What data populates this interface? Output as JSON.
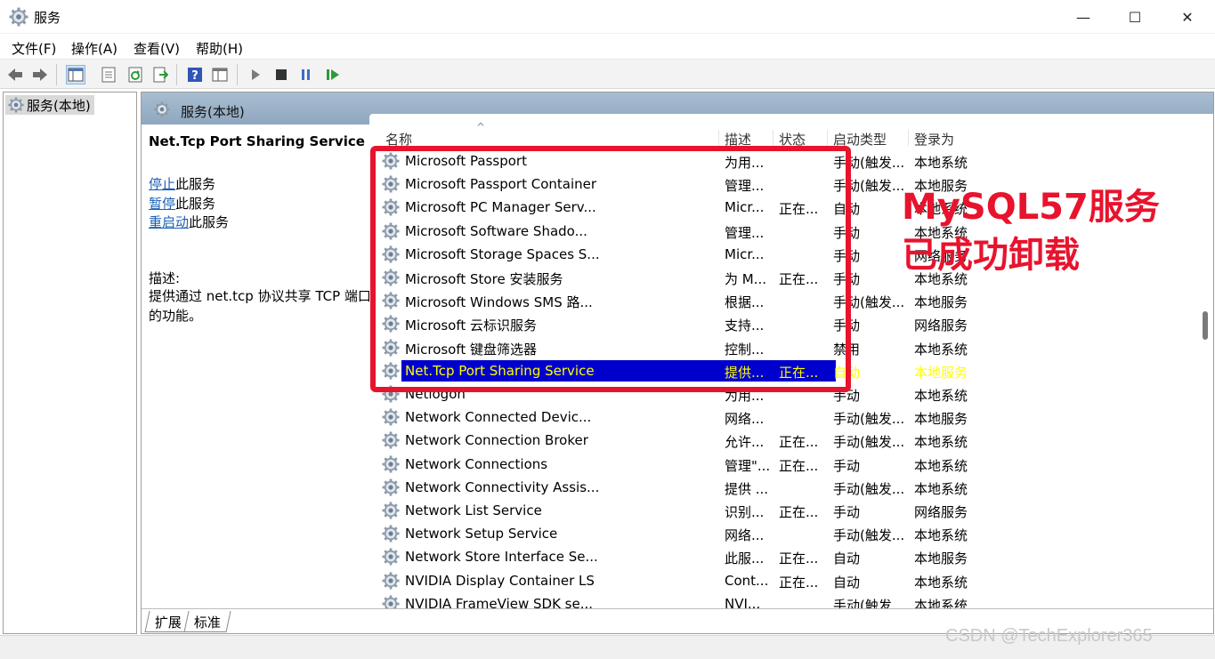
{
  "window": {
    "title": "服务",
    "minimize_glyph": "—",
    "maximize_glyph": "☐",
    "close_glyph": "✕"
  },
  "menu": [
    "文件(F)",
    "操作(A)",
    "查看(V)",
    "帮助(H)"
  ],
  "toolbar_icons": [
    "back-arrow-icon",
    "forward-arrow-icon",
    "show-tree-icon",
    "properties-icon",
    "refresh-icon",
    "export-list-icon",
    "help-icon",
    "console-view-icon",
    "start-service-icon",
    "stop-service-icon",
    "pause-service-icon",
    "resume-service-icon"
  ],
  "tree": {
    "root_label": "服务(本地)"
  },
  "pane_header": {
    "title": "服务(本地)"
  },
  "description": {
    "service_name": "Net.Tcp Port Sharing Service",
    "actions": [
      {
        "link": "停止",
        "suffix": "此服务"
      },
      {
        "link": "暂停",
        "suffix": "此服务"
      },
      {
        "link": "重启动",
        "suffix": "此服务"
      }
    ],
    "label": "描述:",
    "body": "提供通过 net.tcp 协议共享 TCP 端口的功能。"
  },
  "columns": [
    "名称",
    "描述",
    "状态",
    "启动类型",
    "登录为"
  ],
  "sort_glyph": "^",
  "selected_index": 9,
  "services": [
    {
      "name": "Microsoft Passport",
      "desc": "为用...",
      "status": "",
      "startup": "手动(触发...",
      "logon": "本地系统"
    },
    {
      "name": "Microsoft Passport Container",
      "desc": "管理...",
      "status": "",
      "startup": "手动(触发...",
      "logon": "本地服务"
    },
    {
      "name": "Microsoft PC Manager Serv...",
      "desc": "Micr...",
      "status": "正在...",
      "startup": "自动",
      "logon": "本地系统"
    },
    {
      "name": "Microsoft Software Shado...",
      "desc": "管理...",
      "status": "",
      "startup": "手动",
      "logon": "本地系统"
    },
    {
      "name": "Microsoft Storage Spaces S...",
      "desc": "Micr...",
      "status": "",
      "startup": "手动",
      "logon": "网络服务"
    },
    {
      "name": "Microsoft Store 安装服务",
      "desc": "为 M...",
      "status": "正在...",
      "startup": "手动",
      "logon": "本地系统"
    },
    {
      "name": "Microsoft Windows SMS 路...",
      "desc": "根据...",
      "status": "",
      "startup": "手动(触发...",
      "logon": "本地服务"
    },
    {
      "name": "Microsoft 云标识服务",
      "desc": "支持...",
      "status": "",
      "startup": "手动",
      "logon": "网络服务"
    },
    {
      "name": "Microsoft 键盘筛选器",
      "desc": "控制...",
      "status": "",
      "startup": "禁用",
      "logon": "本地系统"
    },
    {
      "name": "Net.Tcp Port Sharing Service",
      "desc": "提供...",
      "status": "正在...",
      "startup": "自动",
      "logon": "本地服务"
    },
    {
      "name": "Netlogon",
      "desc": "为用...",
      "status": "",
      "startup": "手动",
      "logon": "本地系统"
    },
    {
      "name": "Network Connected Devic...",
      "desc": "网络...",
      "status": "",
      "startup": "手动(触发...",
      "logon": "本地服务"
    },
    {
      "name": "Network Connection Broker",
      "desc": "允许...",
      "status": "正在...",
      "startup": "手动(触发...",
      "logon": "本地系统"
    },
    {
      "name": "Network Connections",
      "desc": "管理\"...",
      "status": "正在...",
      "startup": "手动",
      "logon": "本地系统"
    },
    {
      "name": "Network Connectivity Assis...",
      "desc": "提供 ...",
      "status": "",
      "startup": "手动(触发...",
      "logon": "本地系统"
    },
    {
      "name": "Network List Service",
      "desc": "识别...",
      "status": "正在...",
      "startup": "手动",
      "logon": "网络服务"
    },
    {
      "name": "Network Setup Service",
      "desc": "网络...",
      "status": "",
      "startup": "手动(触发...",
      "logon": "本地系统"
    },
    {
      "name": "Network Store Interface Se...",
      "desc": "此服...",
      "status": "正在...",
      "startup": "自动",
      "logon": "本地服务"
    },
    {
      "name": "NVIDIA Display Container LS",
      "desc": "Cont...",
      "status": "正在...",
      "startup": "自动",
      "logon": "本地系统"
    },
    {
      "name": "NVIDIA FrameView SDK se...",
      "desc": "NVI...",
      "status": "",
      "startup": "手动(触发...",
      "logon": "本地系统"
    }
  ],
  "tabs": [
    "扩展",
    "标准"
  ],
  "annotation": {
    "line1": "MySQL57服务",
    "line2": "已成功卸载",
    "color": "#e8132d"
  },
  "watermark": "CSDN @TechExplorer365"
}
